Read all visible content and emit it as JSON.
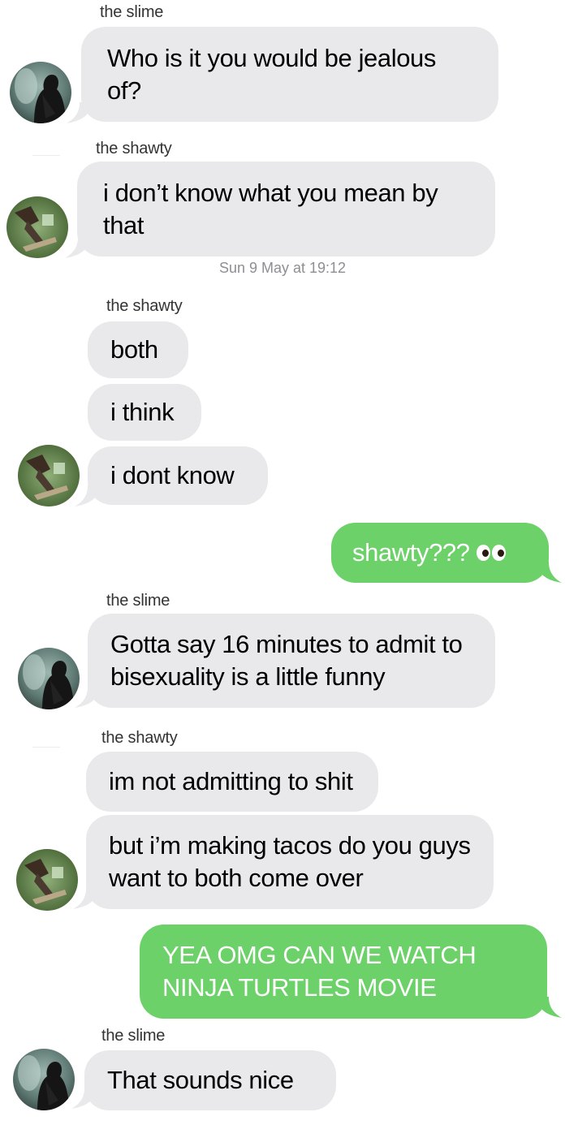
{
  "conversation": {
    "messages": [
      {
        "sender": "the slime",
        "text": "Who is it you would be jealous of?"
      },
      {
        "sender": "the shawty",
        "text": "i don’t know what you mean by that"
      },
      {
        "timestamp": "Sun 9 May at 19:12"
      },
      {
        "sender": "the shawty",
        "text": "both"
      },
      {
        "text": "i think"
      },
      {
        "text": "i dont know"
      },
      {
        "outgoing": true,
        "text": "shawty???",
        "emoji": "eyes"
      },
      {
        "sender": "the slime",
        "text": "Gotta say 16 minutes to admit to bisexuality is a little funny"
      },
      {
        "sender": "the shawty",
        "text": "im not admitting to shit"
      },
      {
        "text": "but i’m making tacos do you guys want to both come over"
      },
      {
        "outgoing": true,
        "text": "YEA OMG CAN WE WATCH NINJA TURTLES MOVIE"
      },
      {
        "sender": "the slime",
        "text": "That sounds nice"
      }
    ]
  },
  "colors": {
    "incoming_bubble": "#e9e9eb",
    "outgoing_bubble": "#6cd168",
    "timestamp": "#8e8e93"
  }
}
